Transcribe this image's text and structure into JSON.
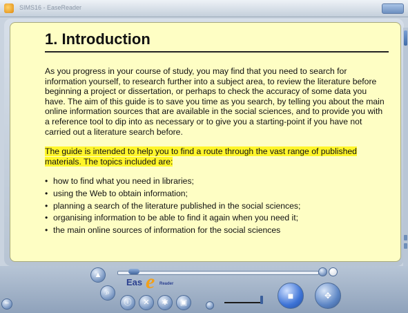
{
  "window": {
    "title": "SIMS16 - EaseReader",
    "app_icon": "app-icon",
    "buttons_icon": "window-buttons-icon"
  },
  "document": {
    "heading": "1. Introduction",
    "paragraph1": "As you progress in your course of study, you may find that you need to search for information yourself, to research further into a subject area, to review the literature before beginning a project or dissertation, or perhaps to check the accuracy of some data you have. The aim of this guide is to save you time as you search, by telling you about the main online information sources that are available in the social sciences, and to provide you with a reference tool to dip into as necessary or to give you a starting-point if you have not carried out a literature search before.",
    "paragraph2_highlighted": "The guide is intended to help you to find a route through the vast range of published materials. The topics included are:",
    "bullets": [
      "how to find what you need in libraries;",
      "using the Web to obtain information;",
      "planning a search of the literature published in the social sciences;",
      "organising information to be able to find it again when you need it;",
      "the main online sources of information for the social sciences"
    ],
    "highlight_color": "#fff52a",
    "page_color": "#fefec4"
  },
  "controls": {
    "logo": {
      "part1": "Eas",
      "part2": "e",
      "part3": "Reader"
    },
    "icons": {
      "up": "eject-up-icon",
      "search": "magnifier-icon",
      "tools": "tools-icon",
      "settings": "gear-icon",
      "info": "info-icon",
      "bookmark": "bookmark-icon",
      "stop": "stop-icon",
      "navigate": "navigation-pad-icon"
    },
    "position_slider_value": 0.05,
    "accent_color": "#3d73d6"
  }
}
